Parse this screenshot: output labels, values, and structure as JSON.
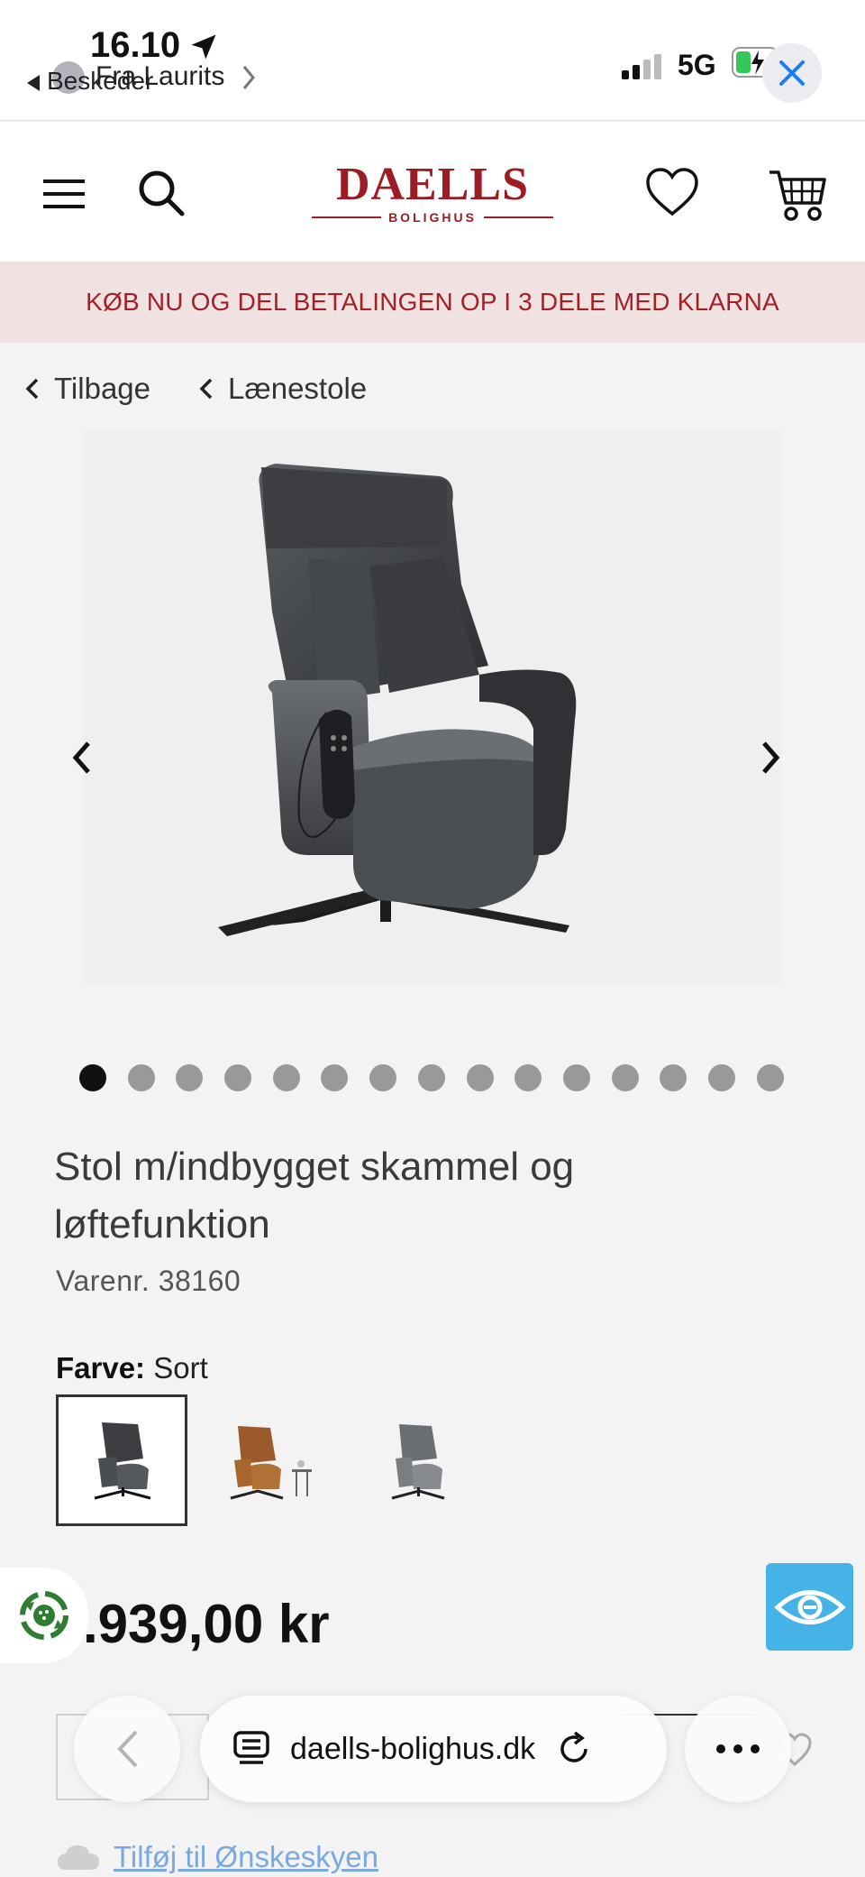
{
  "status_bar": {
    "time": "16.10",
    "back_app": "Beskeder",
    "from_label": "Fra Laurits",
    "network": "5G"
  },
  "header": {
    "logo_main": "DAELLS",
    "logo_sub": "BOLIGHUS"
  },
  "promo": {
    "text": "KØB NU OG DEL BETALINGEN OP I 3 DELE MED KLARNA"
  },
  "breadcrumbs": [
    {
      "label": "Tilbage"
    },
    {
      "label": "Lænestole"
    }
  ],
  "gallery": {
    "image_count": 15,
    "active_index": 0
  },
  "product": {
    "title": "Stol m/indbygget skammel og løftefunktion",
    "sku": "Varenr. 38160",
    "color_label": "Farve:",
    "color_value": "Sort",
    "color_options": [
      "Sort",
      "Cognac",
      "Grå"
    ],
    "price": ".939,00 kr"
  },
  "wishlist": {
    "label": "Tilføj til Ønskeskyen"
  },
  "browser": {
    "url": "daells-bolighus.dk"
  },
  "colors": {
    "brand": "#9b1c22",
    "promo_bg": "#f0e2e1",
    "accessibility": "#46b3e6"
  }
}
